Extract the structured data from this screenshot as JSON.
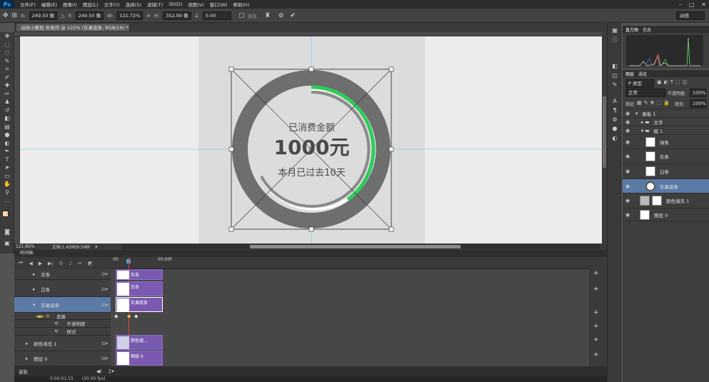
{
  "app": {
    "logo": "Ps",
    "menu": [
      "文件(F)",
      "编辑(E)",
      "图像(I)",
      "图层(L)",
      "文字(Y)",
      "选择(S)",
      "滤镜(T)",
      "3D(D)",
      "视图(V)",
      "窗口(W)",
      "帮助(H)"
    ],
    "window_controls": [
      "–",
      "□",
      "✕"
    ]
  },
  "options": {
    "x_label": "X:",
    "x_value": "249.50 像",
    "y_label": "Y:",
    "y_value": "249.50 像",
    "w_label": "W:",
    "w_value": "121.72%",
    "h_label": "H:",
    "h_value": "352.99 像",
    "angle_value": "0.00",
    "interp_label": "渐变",
    "workspace": "动感"
  },
  "doc": {
    "tab_title": "动效小教程-失败的 @ 122% (灰果底条, RGB/16) *",
    "zoom": "121.85%",
    "doc_info": "文档:1.43M/9.54M"
  },
  "canvas": {
    "title": "已消费金额",
    "amount": "1000元",
    "subtitle": "本月已过去10天",
    "progress": 0.4
  },
  "timeline": {
    "panel_title": "时间轴",
    "time_start": "00",
    "time_end": "05:00f",
    "layers": [
      {
        "name": "灰条",
        "clip": "灰条"
      },
      {
        "name": "白条",
        "clip": "白条"
      },
      {
        "name": "灰果底条",
        "clip": "灰果底条"
      },
      {
        "name": "变换",
        "sub": true
      },
      {
        "name": "不透明度",
        "sub": true
      },
      {
        "name": "样式",
        "sub": true
      },
      {
        "name": "颜色填充 1",
        "clip": "颜色填..."
      },
      {
        "name": "图层 0",
        "clip": "图层 0"
      }
    ],
    "footer_label": "音轨",
    "timecode": "0:00:01:15",
    "fps": "(30.00 fps)"
  },
  "panels": {
    "histogram_tabs": [
      "直方图",
      "信息"
    ],
    "layers_tabs": [
      "图层",
      "通道"
    ],
    "kind_label": "P 类型",
    "blend_mode": "正常",
    "opacity_label": "不透明度:",
    "opacity": "100%",
    "fill_label": "填充:",
    "fill": "100%",
    "lock_label": "锁定:",
    "layers": [
      {
        "name": "画板 1",
        "indent": 0
      },
      {
        "name": "文字",
        "indent": 1
      },
      {
        "name": "组 1",
        "indent": 1
      },
      {
        "name": "绿条",
        "indent": 2
      },
      {
        "name": "灰条",
        "indent": 2
      },
      {
        "name": "白条",
        "indent": 2
      },
      {
        "name": "灰果底条",
        "indent": 2,
        "selected": true
      },
      {
        "name": "颜色填充 1",
        "indent": 1
      },
      {
        "name": "图层 0",
        "indent": 1
      }
    ]
  },
  "colors": {
    "green": "#2ecc5a",
    "ring": "#6e6e6e",
    "selection": "#5b7aa6",
    "clip": "#7a5ab0"
  }
}
